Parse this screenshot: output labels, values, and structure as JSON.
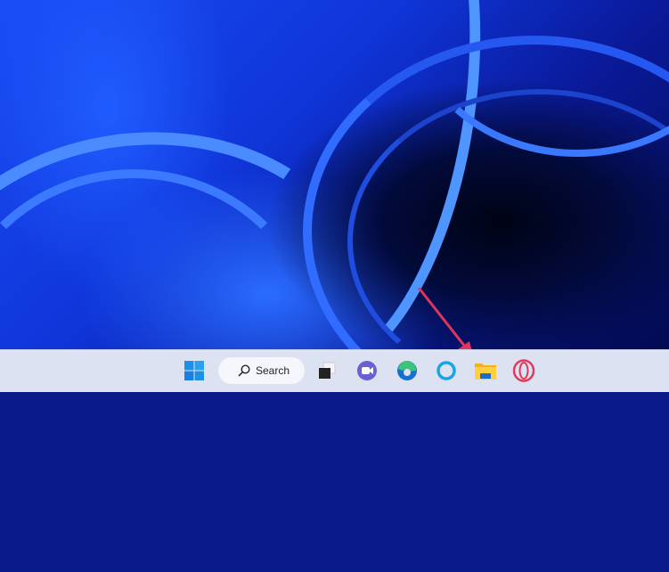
{
  "taskbar": {
    "search_label": "Search",
    "items": [
      {
        "name": "start-button",
        "icon": "windows-logo-icon"
      },
      {
        "name": "task-view-button",
        "icon": "task-view-icon"
      },
      {
        "name": "teams-chat-button",
        "icon": "teams-chat-icon"
      },
      {
        "name": "edge-button",
        "icon": "edge-icon"
      },
      {
        "name": "cortana-button",
        "icon": "cortana-icon"
      },
      {
        "name": "file-explorer-button",
        "icon": "folder-icon"
      },
      {
        "name": "opera-button",
        "icon": "opera-icon"
      }
    ]
  },
  "colors": {
    "accent": "#e0355a",
    "taskbar": "#dde2f2"
  }
}
